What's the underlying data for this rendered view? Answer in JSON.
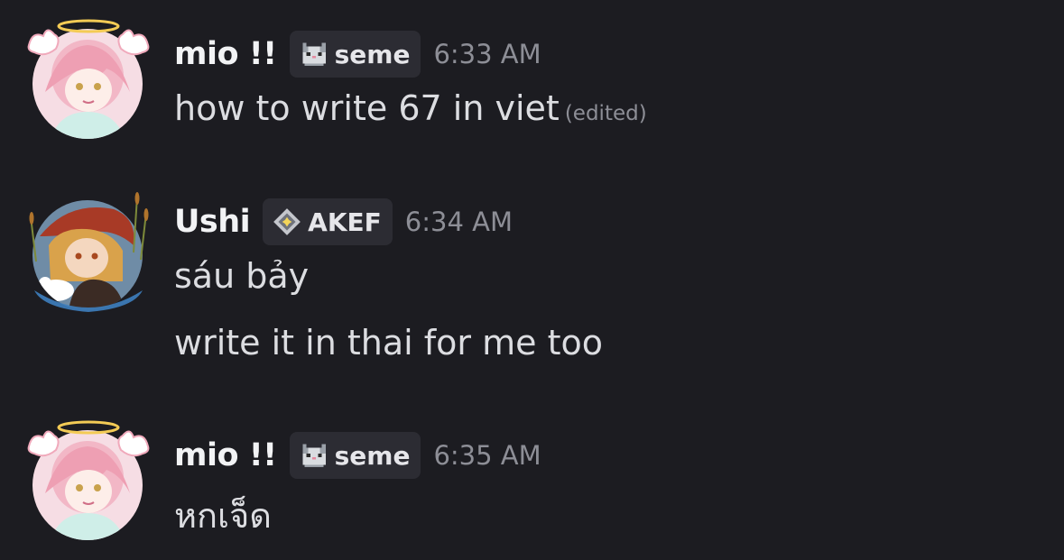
{
  "colors": {
    "background": "#1c1c21",
    "username": "#f2f3f5",
    "message_text": "#dcdde1",
    "timestamp": "#8d8e96",
    "tag_background": "#2c2c33"
  },
  "messages": [
    {
      "author": "mio !!",
      "tag_icon": "pixel-cat-icon",
      "tag": "seme",
      "timestamp": "6:33 AM",
      "lines": [
        {
          "text": "how to write 67 in viet",
          "edited": "(edited)"
        }
      ]
    },
    {
      "author": "Ushi",
      "tag_icon": "diamond-star-icon",
      "tag": "AKEF",
      "timestamp": "6:34 AM",
      "lines": [
        {
          "text": "sáu bảy"
        },
        {
          "text": "write it in thai for me too"
        }
      ]
    },
    {
      "author": "mio !!",
      "tag_icon": "pixel-cat-icon",
      "tag": "seme",
      "timestamp": "6:35 AM",
      "lines": [
        {
          "text": "หกเจ็ด"
        }
      ]
    }
  ]
}
